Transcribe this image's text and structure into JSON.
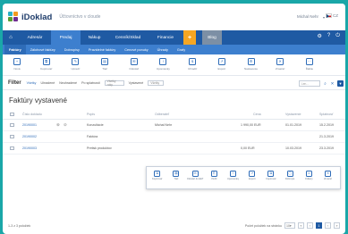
{
  "app": {
    "logo_text": "iDoklad",
    "company_name": "Účtovníctvo v cloude",
    "user_name": "Michal Nehr",
    "lang_label": "CZ"
  },
  "mainnav": {
    "tabs": [
      {
        "label": "Adresár",
        "active": false
      },
      {
        "label": "Predaj",
        "active": true
      },
      {
        "label": "Nákup",
        "active": false
      },
      {
        "label": "Cenník/Sklad",
        "active": false
      },
      {
        "label": "Financie",
        "active": false
      }
    ],
    "plus_label": "+",
    "extra_label": "Blog"
  },
  "subnav": {
    "tabs": [
      {
        "label": "Faktúry",
        "active": true
      },
      {
        "label": "Zálohové faktúry",
        "active": false
      },
      {
        "label": "Dobropisy",
        "active": false
      },
      {
        "label": "Pravidelné faktúry",
        "active": false
      },
      {
        "label": "Cenové ponuky",
        "active": false
      },
      {
        "label": "Úhrady",
        "active": false
      },
      {
        "label": "Grafy",
        "active": false
      }
    ]
  },
  "toolbar": {
    "items": [
      {
        "label": "Nová",
        "icon": "new-icon"
      },
      {
        "label": "Kopírovať",
        "icon": "copy-icon"
      },
      {
        "label": "Upraviť",
        "icon": "edit-icon"
      },
      {
        "label": "Tlač",
        "icon": "print-icon"
      },
      {
        "label": "Odoslať",
        "icon": "send-icon"
      },
      {
        "label": "Upomienky",
        "icon": "reminder-icon"
      },
      {
        "label": "Uhradiť",
        "icon": "pay-icon"
      },
      {
        "label": "Export",
        "icon": "export-icon"
      },
      {
        "label": "Nastavenie",
        "icon": "settings-icon"
      },
      {
        "label": "Zmazať",
        "icon": "delete-icon"
      },
      {
        "label": "Ďalšie",
        "icon": "more-icon"
      }
    ]
  },
  "filter": {
    "title": "Filter",
    "options": [
      {
        "label": "Všetky",
        "active": true
      },
      {
        "label": "Uhradené",
        "active": false
      },
      {
        "label": "Neuhradené",
        "active": false
      },
      {
        "label": "Po splatnosti",
        "active": false
      }
    ],
    "period_select": "Všetky roky",
    "issued_label": "Vystavené",
    "issued_select": "Všetky",
    "search_placeholder": "Len..."
  },
  "page": {
    "title": "Faktúry vystavené"
  },
  "table": {
    "columns": [
      "Číslo dokladu",
      "Popis",
      "Odberateľ",
      "Cena",
      "Vystavenie",
      "Splatnosť"
    ],
    "rows": [
      {
        "number": "20190001",
        "description": "Konzultácie",
        "customer": "Michal Nehr",
        "price": "1 990,00 EUR",
        "issued": "01.01.2019",
        "due": "15.2.2019"
      },
      {
        "number": "20190002",
        "description": "Faktúra",
        "customer": "",
        "price": "",
        "issued": "",
        "due": "21.3.2019"
      },
      {
        "number": "20190003",
        "description": "Pretisk produktov",
        "customer": "",
        "price": "0,00 EUR",
        "issued": "10.03.2019",
        "due": "23.3.2019"
      }
    ]
  },
  "popup": {
    "items": [
      {
        "label": "Kopírovať",
        "icon": "copy-icon"
      },
      {
        "label": "Tlač",
        "icon": "print-icon"
      },
      {
        "label": "Odoslať do EET",
        "icon": "send-icon"
      },
      {
        "label": "Vložiť",
        "icon": "insert-icon"
      },
      {
        "label": "Upomienky",
        "icon": "reminder-icon"
      },
      {
        "label": "Export",
        "icon": "export-icon"
      },
      {
        "label": "Kopírovať",
        "icon": "duplicate-icon"
      },
      {
        "label": "Dobropis",
        "icon": "credit-note-icon"
      },
      {
        "label": "Odkazy",
        "icon": "link-icon"
      },
      {
        "label": "Zmazať",
        "icon": "delete-icon"
      }
    ]
  },
  "footer": {
    "count_text": "1-3 z 3 položiek",
    "per_page_label": "Počet položiek na stránku",
    "per_page_value": "10",
    "pages": [
      "«",
      "‹",
      "1",
      "›",
      "»"
    ],
    "active_page": "1"
  },
  "colors": {
    "background": "#1aa7a8",
    "nav_dark": "#1f5aa3",
    "nav_light": "#3d7fce",
    "accent_orange": "#f5a623"
  }
}
